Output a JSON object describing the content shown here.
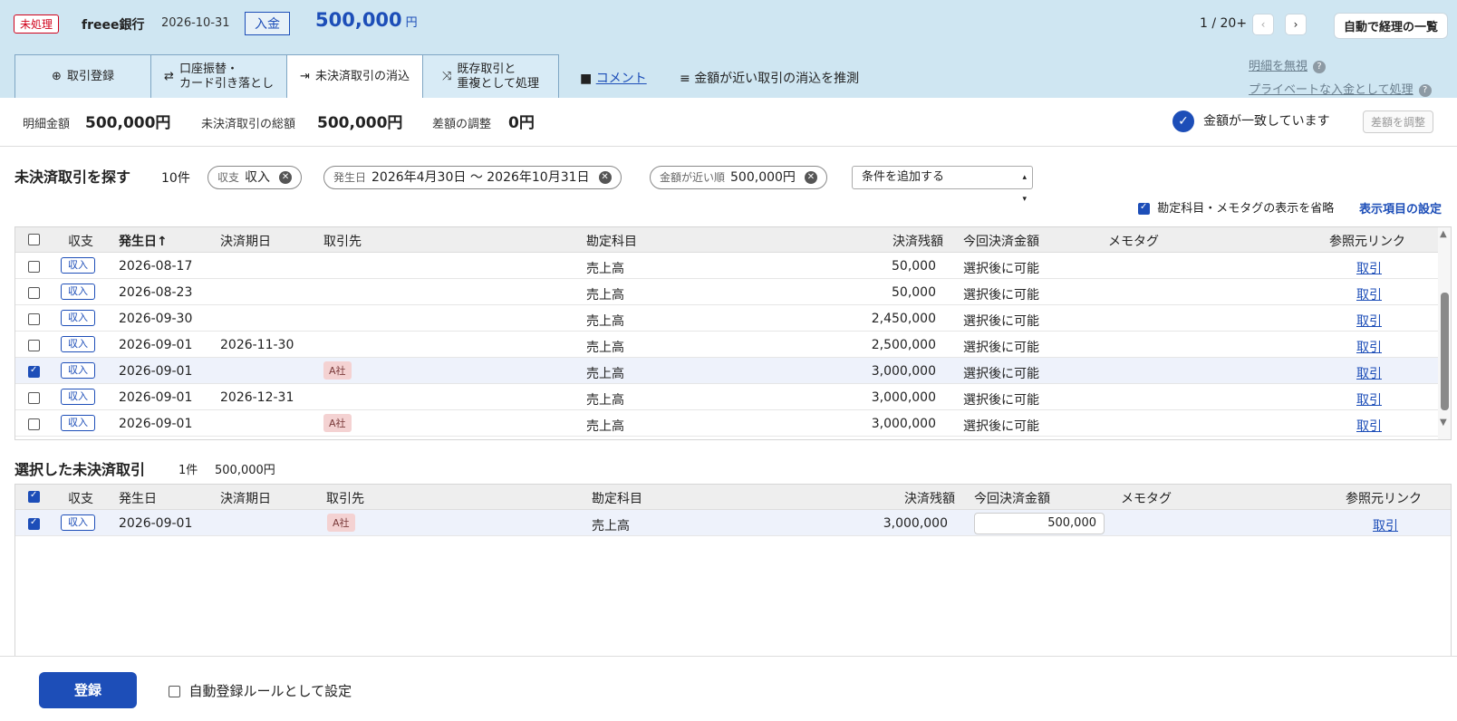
{
  "header": {
    "status_badge": "未処理",
    "bank_name": "freee銀行",
    "date": "2026-10-31",
    "type_badge": "入金",
    "amount": "500,000",
    "amount_unit": "円",
    "pager": "1 / 20+",
    "prev_icon": "chevron-left-icon",
    "next_icon": "chevron-right-icon",
    "auto_list_label": "自動で経理の一覧"
  },
  "tabs": [
    {
      "icon": "⊕",
      "label": "取引登録"
    },
    {
      "icon": "⇄",
      "label": "口座振替・\nカード引き落とし"
    },
    {
      "icon": "⇥",
      "label": "未決済取引の消込"
    },
    {
      "icon": "⤨",
      "label": "既存取引と\n重複として処理"
    }
  ],
  "actions": {
    "comment": "コメント",
    "guess": "金額が近い取引の消込を推測",
    "ignore": "明細を無視",
    "private": "プライベートな入金として処理"
  },
  "summary": {
    "detail_label": "明細金額",
    "detail_value": "500,000円",
    "total_label": "未決済取引の総額",
    "total_value": "500,000円",
    "diff_label": "差額の調整",
    "diff_value": "0円",
    "match_text": "金額が一致しています",
    "adjust_btn": "差額を調整"
  },
  "search": {
    "title": "未決済取引を探す",
    "count": "10件",
    "chips": [
      {
        "key": "収支",
        "value": "収入"
      },
      {
        "key": "発生日",
        "value": "2026年4月30日 〜 2026年10月31日"
      },
      {
        "key": "金額が近い順",
        "value": "500,000円"
      }
    ],
    "add_condition": "条件を追加する",
    "omit_label": "勘定科目・メモタグの表示を省略",
    "settings_link": "表示項目の設定"
  },
  "columns": {
    "type": "収支",
    "date": "発生日",
    "due": "決済期日",
    "partner": "取引先",
    "account": "勘定科目",
    "balance": "決済残額",
    "this_amount": "今回決済金額",
    "memo": "メモタグ",
    "ref": "参照元リンク"
  },
  "rows": [
    {
      "checked": false,
      "type": "収入",
      "date": "2026-08-17",
      "due": "",
      "partner": "",
      "account": "売上高",
      "balance": "50,000",
      "this_amount": "選択後に可能",
      "ref": "取引"
    },
    {
      "checked": false,
      "type": "収入",
      "date": "2026-08-23",
      "due": "",
      "partner": "",
      "account": "売上高",
      "balance": "50,000",
      "this_amount": "選択後に可能",
      "ref": "取引"
    },
    {
      "checked": false,
      "type": "収入",
      "date": "2026-09-30",
      "due": "",
      "partner": "",
      "account": "売上高",
      "balance": "2,450,000",
      "this_amount": "選択後に可能",
      "ref": "取引"
    },
    {
      "checked": false,
      "type": "収入",
      "date": "2026-09-01",
      "due": "2026-11-30",
      "partner": "",
      "account": "売上高",
      "balance": "2,500,000",
      "this_amount": "選択後に可能",
      "ref": "取引"
    },
    {
      "checked": true,
      "type": "収入",
      "date": "2026-09-01",
      "due": "",
      "partner": "A社",
      "account": "売上高",
      "balance": "3,000,000",
      "this_amount": "選択後に可能",
      "ref": "取引"
    },
    {
      "checked": false,
      "type": "収入",
      "date": "2026-09-01",
      "due": "2026-12-31",
      "partner": "",
      "account": "売上高",
      "balance": "3,000,000",
      "this_amount": "選択後に可能",
      "ref": "取引"
    },
    {
      "checked": false,
      "type": "収入",
      "date": "2026-09-01",
      "due": "",
      "partner": "A社",
      "account": "売上高",
      "balance": "3,000,000",
      "this_amount": "選択後に可能",
      "ref": "取引"
    }
  ],
  "selected": {
    "title": "選択した未決済取引",
    "count": "1件",
    "total": "500,000円",
    "rows": [
      {
        "checked": true,
        "type": "収入",
        "date": "2026-09-01",
        "due": "",
        "partner": "A社",
        "account": "売上高",
        "balance": "3,000,000",
        "this_amount": "500,000",
        "ref": "取引"
      }
    ]
  },
  "footer": {
    "register": "登録",
    "auto_rule": "自動登録ルールとして設定"
  }
}
